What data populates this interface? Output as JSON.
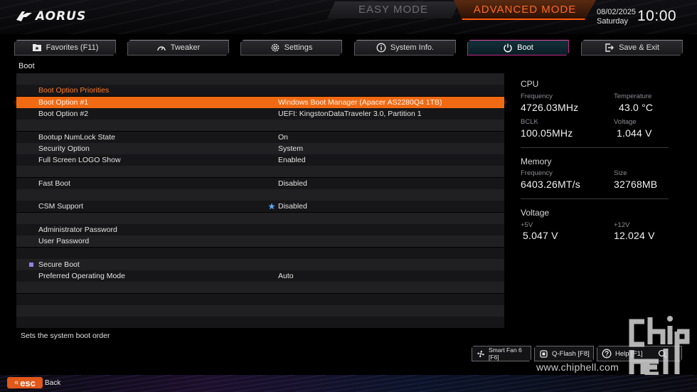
{
  "header": {
    "brand": "AORUS",
    "easy_mode": "EASY MODE",
    "advanced_mode": "ADVANCED MODE",
    "date": "08/02/2025",
    "weekday": "Saturday",
    "time": "10:00"
  },
  "tabs": [
    {
      "label": "Favorites (F11)",
      "icon": "star-folder-icon",
      "active": false
    },
    {
      "label": "Tweaker",
      "icon": "gauge-icon",
      "active": false
    },
    {
      "label": "Settings",
      "icon": "gear-icon",
      "active": false
    },
    {
      "label": "System Info.",
      "icon": "info-icon",
      "active": false
    },
    {
      "label": "Boot",
      "icon": "power-icon",
      "active": true
    },
    {
      "label": "Save & Exit",
      "icon": "exit-icon",
      "active": false
    }
  ],
  "page_title": "Boot",
  "rows": [
    {
      "label": "",
      "value": ""
    },
    {
      "label": "Boot Option Priorities",
      "value": "",
      "section": true
    },
    {
      "label": "Boot Option #1",
      "value": "Windows Boot Manager (Apacer AS2280Q4 1TB)",
      "selected": true
    },
    {
      "label": "Boot Option #2",
      "value": "UEFI: KingstonDataTraveler 3.0, Partition 1"
    },
    {
      "label": "",
      "value": ""
    },
    {
      "label": "Bootup NumLock State",
      "value": "On"
    },
    {
      "label": "Security Option",
      "value": "System"
    },
    {
      "label": "Full Screen LOGO Show",
      "value": "Enabled"
    },
    {
      "label": "",
      "value": ""
    },
    {
      "label": "Fast Boot",
      "value": "Disabled"
    },
    {
      "label": "",
      "value": ""
    },
    {
      "label": "CSM Support",
      "value": "Disabled",
      "star": true
    },
    {
      "label": "",
      "value": ""
    },
    {
      "label": "Administrator Password",
      "value": ""
    },
    {
      "label": "User Password",
      "value": ""
    },
    {
      "label": "",
      "value": ""
    },
    {
      "label": "Secure Boot",
      "value": "",
      "bullet": true
    },
    {
      "label": "Preferred Operating Mode",
      "value": "Auto"
    },
    {
      "label": "",
      "value": ""
    },
    {
      "label": "",
      "value": ""
    },
    {
      "label": "",
      "value": ""
    },
    {
      "label": "",
      "value": ""
    }
  ],
  "help_text": "Sets the system boot order",
  "hw": {
    "cpu": {
      "title": "CPU",
      "frequency_label": "Frequency",
      "frequency": "4726.03MHz",
      "temperature_label": "Temperature",
      "temperature": "43.0 °C",
      "bclk_label": "BCLK",
      "bclk": "100.05MHz",
      "voltage_label": "Voltage",
      "voltage": "1.044 V"
    },
    "memory": {
      "title": "Memory",
      "frequency_label": "Frequency",
      "frequency": "6403.26MT/s",
      "size_label": "Size",
      "size": "32768MB"
    },
    "voltage": {
      "title": "Voltage",
      "v5_label": "+5V",
      "v5": "5.047 V",
      "v12_label": "+12V",
      "v12": "12.024 V"
    }
  },
  "bottom_buttons": {
    "smart_fan": "Smart Fan 6 [F6]",
    "qflash": "Q-Flash [F8]",
    "help": "Help [F1]"
  },
  "footer": {
    "esc": "esc",
    "back": "Back"
  },
  "watermark": "www.chiphell.com",
  "colors": {
    "accent_orange": "#f06a14",
    "active_tab_border": "#c02a86",
    "section_text": "#ff7a2a"
  }
}
